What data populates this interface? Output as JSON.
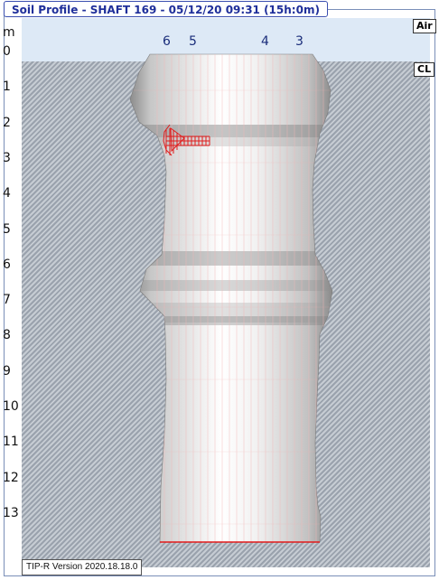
{
  "title": "Soil Profile - SHAFT 169 - 05/12/20 09:31 (15h:0m)",
  "unit": "m",
  "depth_ticks": [
    "0",
    "1",
    "2",
    "3",
    "4",
    "5",
    "6",
    "7",
    "8",
    "9",
    "10",
    "11",
    "12",
    "13"
  ],
  "channel_labels": [
    "6",
    "5",
    "4",
    "3"
  ],
  "layers": {
    "air": "Air",
    "clay": "CL"
  },
  "version": "TIP-R Version 2020.18.18.0"
}
